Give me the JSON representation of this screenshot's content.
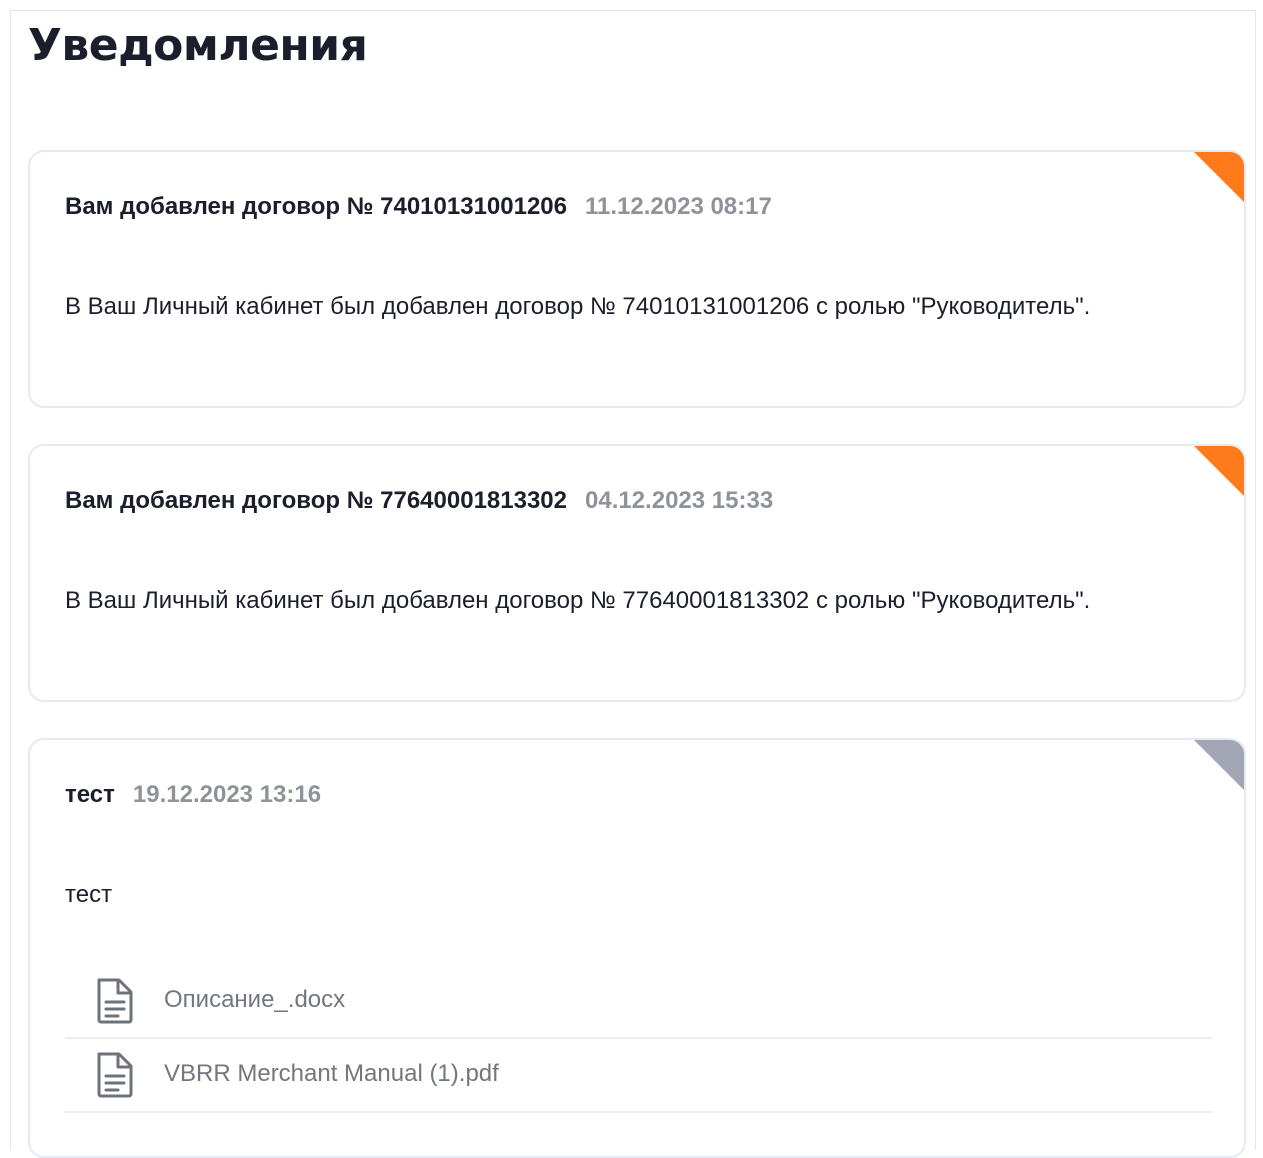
{
  "page": {
    "title": "Уведомления"
  },
  "colors": {
    "unread_marker": "#ff7a1a",
    "read_marker": "#a2a5b4",
    "card_border": "#e6eaf7",
    "date_text": "#8f9299"
  },
  "notifications": [
    {
      "title": "Вам добавлен договор № 74010131001206",
      "date": "11.12.2023 08:17",
      "body": "В Ваш Личный кабинет был добавлен договор № 74010131001206 с ролью \"Руководитель\".",
      "status": "unread",
      "marker_icon": "unread-corner-marker"
    },
    {
      "title": "Вам добавлен договор № 77640001813302",
      "date": "04.12.2023 15:33",
      "body": "В Ваш Личный кабинет был добавлен договор № 77640001813302 с ролью \"Руководитель\".",
      "status": "unread",
      "marker_icon": "unread-corner-marker"
    },
    {
      "title": "тест",
      "date": "19.12.2023 13:16",
      "body": "тест",
      "status": "read",
      "marker_icon": "read-corner-marker",
      "attachments": [
        {
          "name": "Описание_.docx",
          "icon": "document-icon"
        },
        {
          "name": "VBRR Merchant Manual (1).pdf",
          "icon": "document-icon"
        }
      ]
    }
  ]
}
